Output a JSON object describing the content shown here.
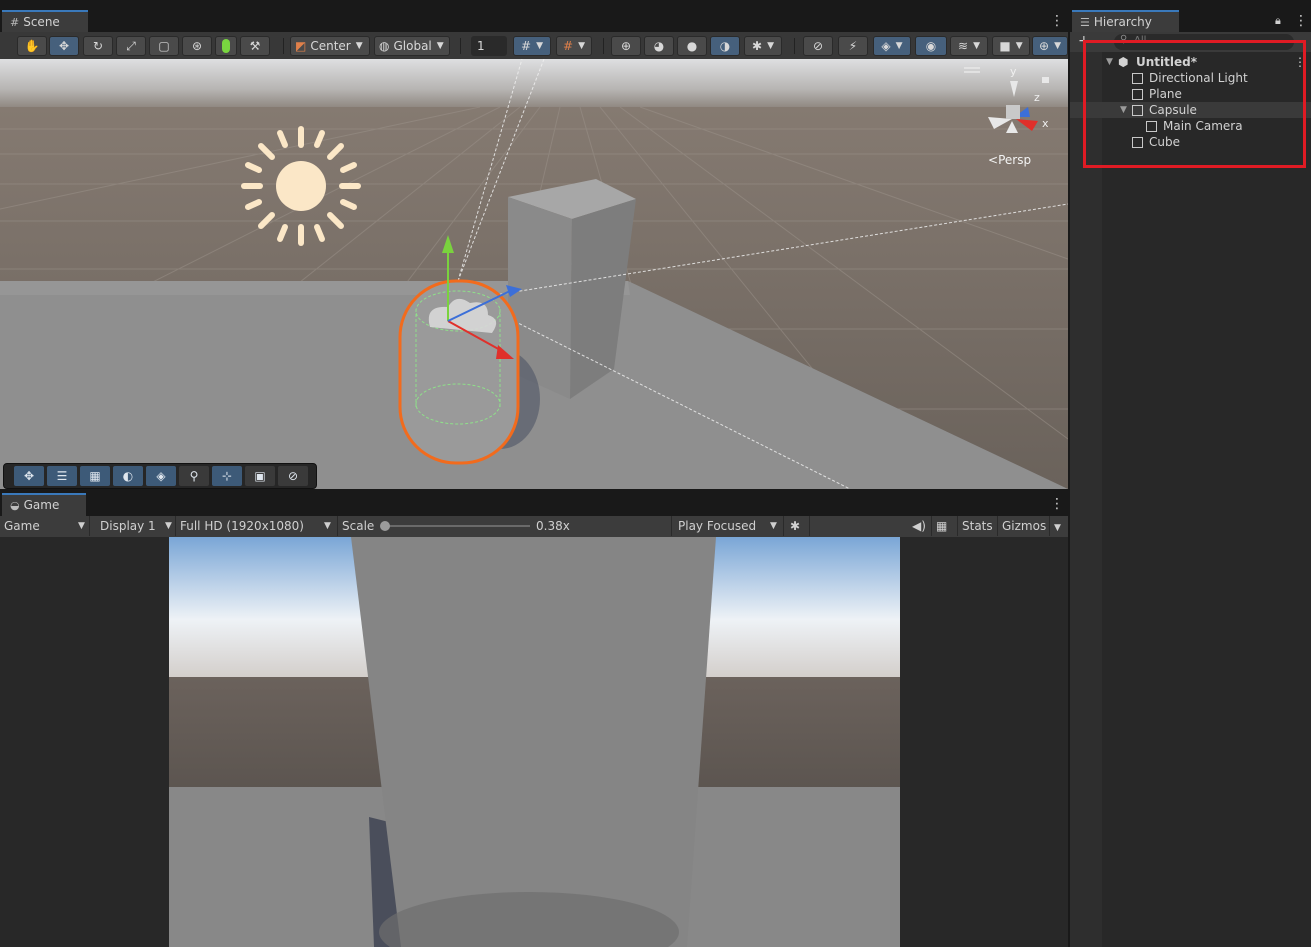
{
  "scene": {
    "tab_label": "Scene",
    "tab_icon": "grid-icon",
    "toolbar": {
      "pivot_label": "Center",
      "space_label": "Global",
      "grid_increment": "1"
    },
    "persp_label": "Persp",
    "gizmo_axes": {
      "y": "y",
      "z": "z",
      "x": "x"
    },
    "colors": {
      "selection_outline": "#f26b1d",
      "active_tool": "#46607c"
    }
  },
  "game": {
    "tab_label": "Game",
    "tab_icon": "gamepad-icon",
    "view_mode": "Game",
    "display": "Display 1",
    "resolution": "Full HD (1920x1080)",
    "scale_label": "Scale",
    "scale_value": 0.38,
    "scale_readout": "0.38x",
    "play_mode": "Play Focused",
    "stats_label": "Stats",
    "gizmos_label": "Gizmos"
  },
  "hierarchy": {
    "tab_label": "Hierarchy",
    "search_placeholder": "All",
    "scene_name": "Untitled*",
    "items": [
      {
        "label": "Directional Light",
        "depth": 1
      },
      {
        "label": "Plane",
        "depth": 1
      },
      {
        "label": "Capsule",
        "depth": 1,
        "expanded": true,
        "selected": true
      },
      {
        "label": "Main Camera",
        "depth": 2
      },
      {
        "label": "Cube",
        "depth": 1
      }
    ],
    "highlight_color": "#e01b24"
  }
}
